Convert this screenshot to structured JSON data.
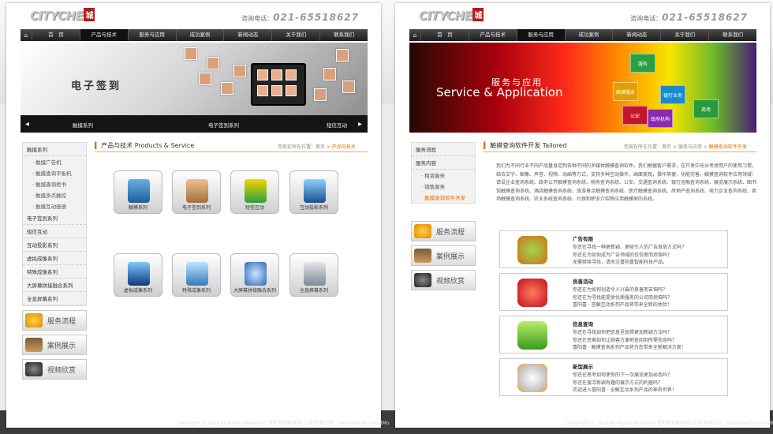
{
  "left": {
    "logo": "CITYCHE",
    "seal": "城",
    "hotline_label": "咨询电话：",
    "hotline": "021-65518627",
    "nav": {
      "home_icon": "home-icon",
      "items": [
        "首　页",
        "产品与技术",
        "服务与应用",
        "成功案例",
        "新闻动态",
        "关于我们",
        "联系我们"
      ],
      "active": 1
    },
    "banner": {
      "title": "电子签到",
      "strip": [
        "触摸系列",
        "电子签到系列",
        "短信互动"
      ]
    },
    "side": {
      "groups": [
        {
          "title": "触摸系列",
          "subs": [
            "触摸广告机",
            "触摸查询平板机",
            "触摸查询柜书",
            "触摸多点触控",
            "触摸互动画册"
          ]
        },
        {
          "title": "电子签到系列"
        },
        {
          "title": "短信互动"
        },
        {
          "title": "互动投影系列"
        },
        {
          "title": "虚拟成像系列"
        },
        {
          "title": "特殊成像系列"
        },
        {
          "title": "大屏幕拼接融合系列"
        },
        {
          "title": "全息屏幕系列"
        }
      ],
      "buttons": [
        "服务流程",
        "案例展示",
        "视频欣赏"
      ]
    },
    "section_title": "产品与技术",
    "section_title_en": "Products & Service",
    "crumb_prefix": "您现在所在位置：首页 > ",
    "crumb_current": "产品与技术",
    "products": [
      "触摸系列",
      "电子签到系列",
      "短信互动",
      "互动投影系列",
      "虚拟成像系列",
      "特殊成像系列",
      "大屏幕拼接融合系列",
      "全息屏幕系列"
    ],
    "footer": "Copyright © 2010 all Rights Reserved 喜阳喜智能科技(上海)有限公司　Designed by GreatMo"
  },
  "right": {
    "logo": "CITYCHE",
    "seal": "城",
    "hotline_label": "咨询电话：",
    "hotline": "021-65518627",
    "nav": {
      "items": [
        "首　页",
        "产品与技术",
        "服务与应用",
        "成功案例",
        "新闻动态",
        "关于我们",
        "联系我们"
      ],
      "active": 2
    },
    "banner": {
      "title_en": "Service & Application",
      "title_cn": "服务与应用",
      "cubes": [
        "服务",
        "银行业务",
        "触摸服务",
        "公安",
        "商场",
        "政府机构"
      ]
    },
    "side": {
      "items": [
        {
          "title": "服务流程"
        },
        {
          "title": "服务内容",
          "subs": [
            "租赁服务",
            "销售服务",
            "触摸查询软件开发"
          ],
          "current": 2
        }
      ],
      "buttons": [
        "服务流程",
        "案例展示",
        "视频欣赏"
      ]
    },
    "section_title": "触摸查询软件开发",
    "section_title_en": "Tailored",
    "crumb_prefix": "您现在所在位置：首页 > 服务与应用 > ",
    "crumb_current": "触摸查询软件开发",
    "paragraph": "我们为不同行业不同产品量身定制各种不同的多媒体触摸查询软件。我们根据客户需求，在开发中充分考虑用户的使用习惯，结合文字、图像、声音、视频、动画等方式，支持多种互动操作，画面美观，操作简便，功能完善。触摸查询软件应用领域：请设企业查询系统、政务公开触摸查询系统、税务查询系统、公安、交通查询系统、银行金融查询系统、展览展示系统、图书馆触摸查询系统、酒店触摸查询系统、旅游景点触摸查询系统、医疗触摸查询系统、房地产查询系统、电力企业查询系统、商场触摸查询系统、农业系统查询系统、社保和职业介绍等应用触摸屏的系统。",
    "features": [
      {
        "title": "广告有限",
        "lines": [
          "你还在寻找一种更新颖、更吸引人的广告发放方式吗？",
          "你还在为如何成为广告领域的佼佼者而烦恼吗？",
          "无需继续寻找，请关注喜阳喜智能科技产品。"
        ]
      },
      {
        "title": "良善活动",
        "lines": [
          "你还在为如何创造令人兴奋的良善而苦恼吗？",
          "你还在为寻找能提供优质服务的公司而烦恼吗？",
          "喜阳喜 · 签触互动系列产品将带来全新的体验！"
        ]
      },
      {
        "title": "信息查询",
        "lines": [
          "你还在寻找如何把信息呈现得更加新颖方法吗？",
          "你还在思索如何让顾客方便地查阅到所需信息吗？",
          "喜阳喜 · 触摸查询系列产品将为您带来全新解决方案！"
        ]
      },
      {
        "title": "新型展示",
        "lines": [
          "你还在思考如何使你的下一次展览更加出色吗？",
          "你还在搜寻新颖有趣的展示方式的利器吗？",
          "欢迎进入喜阳喜 · 全触互动系列产品的神奇世界！"
        ]
      }
    ],
    "footer": "Copyright © 2010 all Rights Reserved 喜阳喜智能科技(上海)有限公司　Designed by GreatMo"
  },
  "colors": {
    "accent": "#e07000",
    "nav": "#2a2a2a",
    "footer": "#3c3c3c"
  }
}
